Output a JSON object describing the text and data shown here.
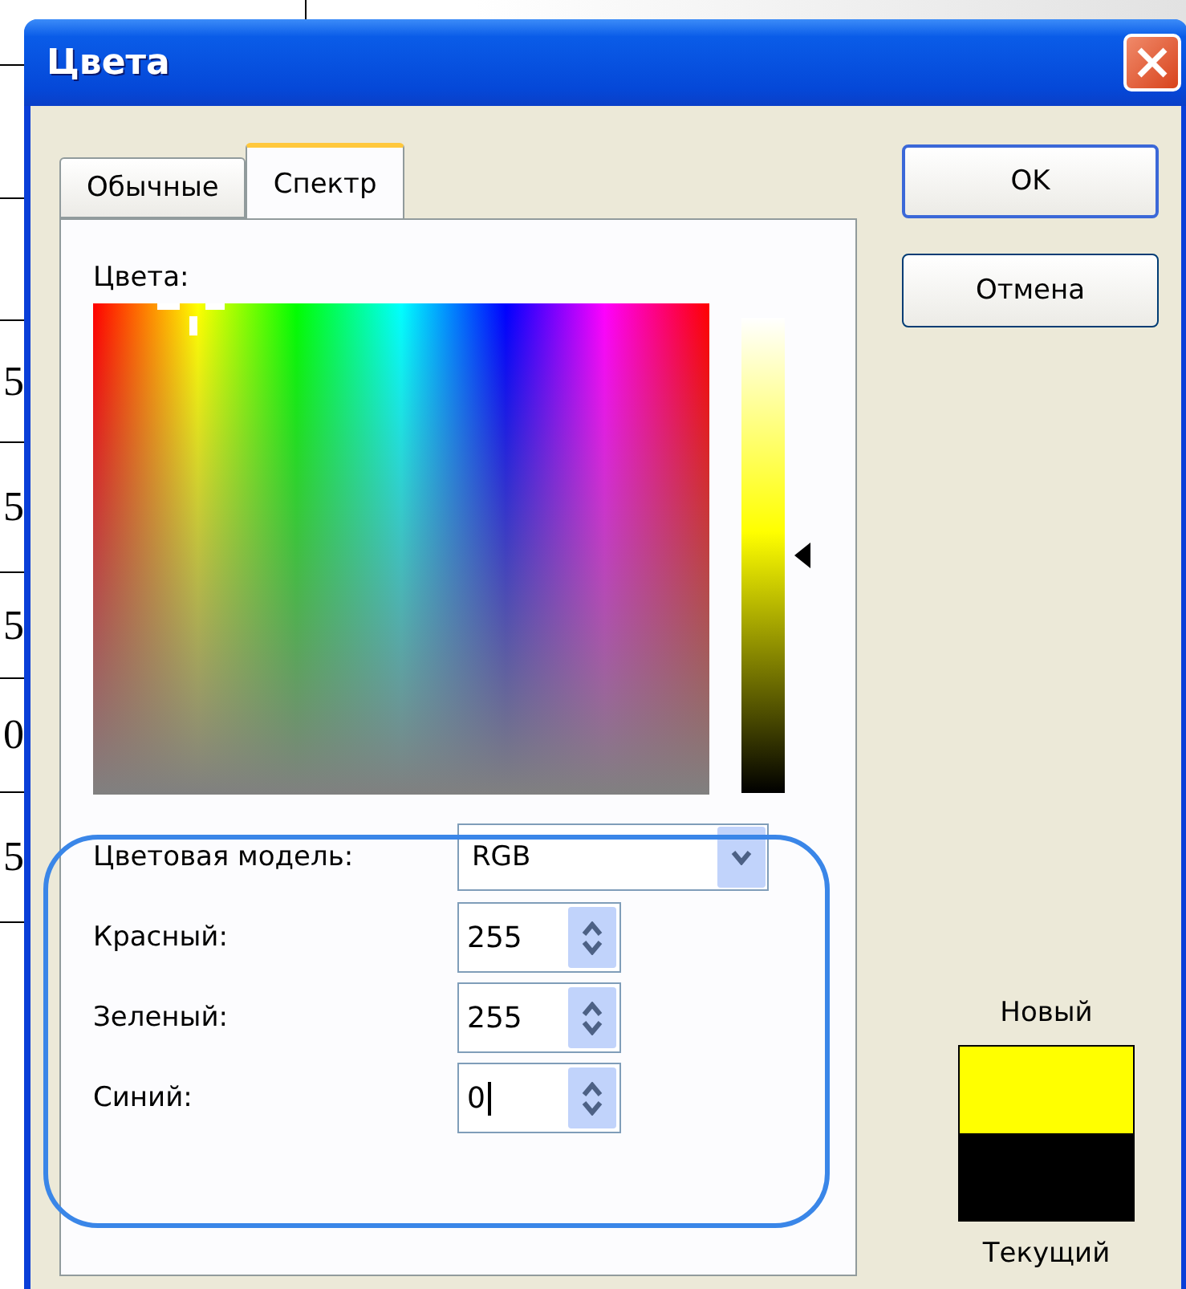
{
  "background_table": {
    "cells": [
      "5",
      "5",
      "5",
      "0",
      "5"
    ]
  },
  "window": {
    "title": "Цвета"
  },
  "tabs": [
    {
      "label": "Обычные",
      "selected": false
    },
    {
      "label": "Спектр",
      "selected": true
    }
  ],
  "spectrum": {
    "label": "Цвета:"
  },
  "luminance": {
    "level": 0.5
  },
  "color_model": {
    "label": "Цветовая модель:",
    "value": "RGB"
  },
  "channels": [
    {
      "label": "Красный:",
      "value": "255",
      "focused": false
    },
    {
      "label": "Зеленый:",
      "value": "255",
      "focused": false
    },
    {
      "label": "Синий:",
      "value": "0",
      "focused": true
    }
  ],
  "buttons": [
    {
      "label": "OK",
      "default": true
    },
    {
      "label": "Отмена",
      "default": false
    }
  ],
  "preview": {
    "swatches": [
      {
        "label": "Новый",
        "color": "#ffff00"
      },
      {
        "label": "Текущий",
        "color": "#000000"
      }
    ]
  }
}
